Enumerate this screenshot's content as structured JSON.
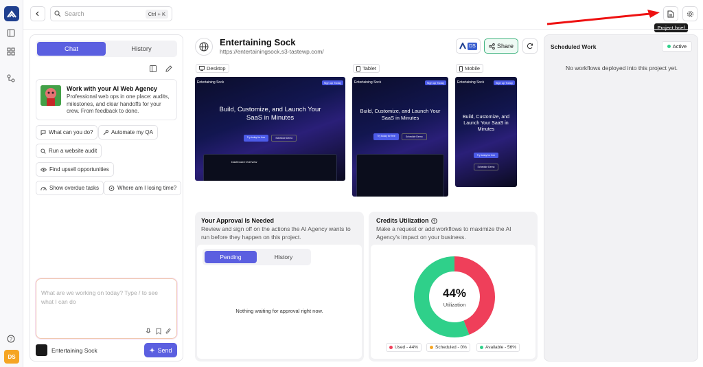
{
  "topbar": {
    "search_placeholder": "Search",
    "search_shortcut": "Ctrl + K",
    "tooltip": "Project brief"
  },
  "rail": {
    "avatar": "DS"
  },
  "chat": {
    "tabs": [
      "Chat",
      "History"
    ],
    "welcome_title": "Work with your AI Web Agency",
    "welcome_desc": "Professional web ops in one place: audits, milestones, and clear handoffs for your crew. From feedback to done.",
    "suggestions": [
      "What can you do?",
      "Automate my QA",
      "Run a website audit",
      "Find upsell opportunities",
      "Show overdue tasks",
      "Where am I losing time?"
    ],
    "composer_placeholder": "What are we working on today? Type / to see what I can do",
    "project_name": "Entertaining Sock",
    "send_label": "Send"
  },
  "project": {
    "title": "Entertaining Sock",
    "url": "https://entertainingsock.s3-tastewp.com/",
    "agency_badge": "DS",
    "share_label": "Share"
  },
  "previews": {
    "desktop_label": "Desktop",
    "tablet_label": "Tablet",
    "mobile_label": "Mobile",
    "site_name": "Entertaining Sock",
    "nav_button": "Sign up Today",
    "hero": "Build, Customize, and Launch Your SaaS in Minutes",
    "primary_cta": "Try today for free",
    "secondary_cta": "Schedule Demo",
    "dash_title": "Dashboard Overview"
  },
  "approval": {
    "title": "Your Approval Is Needed",
    "desc": "Review and sign off on the actions the AI Agency wants to run before they happen on this project.",
    "tabs": [
      "Pending",
      "History"
    ],
    "empty": "Nothing waiting for approval right now."
  },
  "credits": {
    "title": "Credits Utilization",
    "desc": "Make a request or add workflows to maximize the AI Agency's impact on your business.",
    "center_value": "44%",
    "center_label": "Utilization",
    "legend": [
      "Used - 44%",
      "Scheduled - 0%",
      "Available - 56%"
    ],
    "chart_data": {
      "type": "pie",
      "categories": [
        "Used",
        "Scheduled",
        "Available"
      ],
      "values": [
        44,
        0,
        56
      ],
      "colors": [
        "#ef3f5a",
        "#f5a524",
        "#2fd08a"
      ]
    }
  },
  "scheduled": {
    "title": "Scheduled Work",
    "status": "Active",
    "empty": "No workflows deployed into this project yet."
  }
}
